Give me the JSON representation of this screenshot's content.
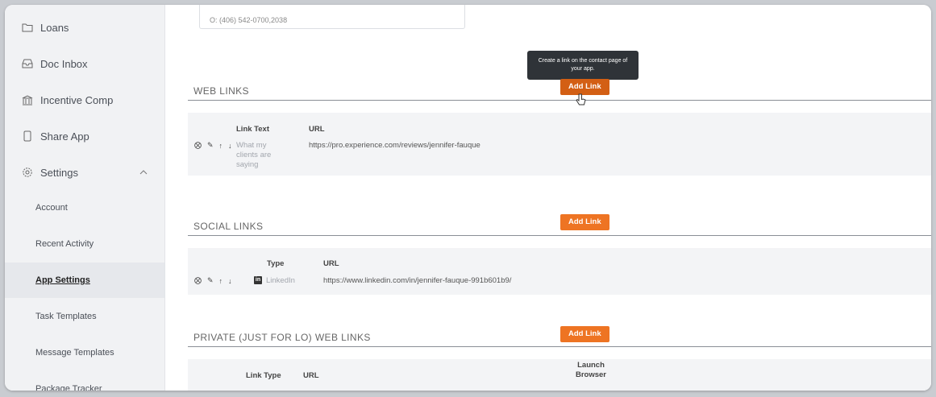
{
  "sidebar": {
    "items": [
      {
        "label": "Loans",
        "icon": "folder-icon"
      },
      {
        "label": "Doc Inbox",
        "icon": "inbox-icon"
      },
      {
        "label": "Incentive Comp",
        "icon": "bank-icon"
      },
      {
        "label": "Share App",
        "icon": "phone-icon"
      },
      {
        "label": "Settings",
        "icon": "gear-icon"
      }
    ],
    "sub_items": [
      "Account",
      "Recent Activity",
      "App Settings",
      "Task Templates",
      "Message Templates",
      "Package Tracker"
    ],
    "active_sub_item": "App Settings"
  },
  "contact": {
    "phone": "O: (406) 542-0700,2038"
  },
  "tooltip": {
    "text": "Create a link on the contact page of your app."
  },
  "web_links": {
    "title": "WEB LINKS",
    "add_label": "Add Link",
    "columns": [
      "Link Text",
      "URL"
    ],
    "rows": [
      {
        "text": "What my clients are saying",
        "url": "https://pro.experience.com/reviews/jennifer-fauque"
      }
    ]
  },
  "social_links": {
    "title": "SOCIAL LINKS",
    "add_label": "Add Link",
    "columns": [
      "Type",
      "URL"
    ],
    "rows": [
      {
        "type": "LinkedIn",
        "url": "https://www.linkedin.com/in/jennifer-fauque-991b601b9/"
      }
    ]
  },
  "private_links": {
    "title": "PRIVATE (JUST FOR LO) WEB LINKS",
    "add_label": "Add Link",
    "columns": [
      "Link Type",
      "URL",
      "Launch Browser"
    ]
  },
  "colors": {
    "accent": "#ee7423",
    "accent_hover": "#d35f14"
  }
}
